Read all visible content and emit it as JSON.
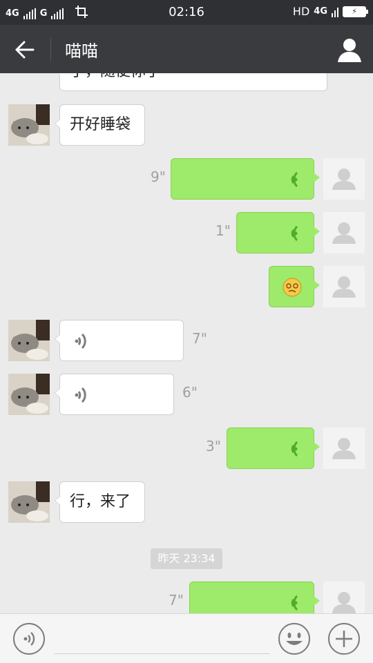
{
  "status_bar": {
    "network_1": "4G",
    "network_2": "G",
    "time": "02:16",
    "hd": "HD",
    "network_3": "4G"
  },
  "header": {
    "title": "喵喵"
  },
  "messages": [
    {
      "id": 1,
      "direction": "incoming",
      "type": "text",
      "text": "了，随便你了"
    },
    {
      "id": 2,
      "direction": "incoming",
      "type": "text",
      "text": "开好睡袋"
    },
    {
      "id": 3,
      "direction": "outgoing",
      "type": "voice",
      "duration": "9\""
    },
    {
      "id": 4,
      "direction": "outgoing",
      "type": "voice",
      "duration": "1\""
    },
    {
      "id": 5,
      "direction": "outgoing",
      "type": "emoji",
      "emoji": "dizzy-face-emoji"
    },
    {
      "id": 6,
      "direction": "incoming",
      "type": "voice",
      "duration": "7\""
    },
    {
      "id": 7,
      "direction": "incoming",
      "type": "voice",
      "duration": "6\""
    },
    {
      "id": 8,
      "direction": "outgoing",
      "type": "voice",
      "duration": "3\""
    },
    {
      "id": 9,
      "direction": "incoming",
      "type": "text",
      "text": "行，来了"
    },
    {
      "id": 10,
      "direction": "outgoing",
      "type": "voice",
      "duration": "7\""
    }
  ],
  "timestamp": "昨天 23:34",
  "input": {
    "value": "",
    "placeholder": ""
  },
  "icons": {
    "back": "back-arrow-icon",
    "profile": "person-icon",
    "voice": "voice-mode-icon",
    "emoji": "smiley-icon",
    "more": "plus-icon"
  },
  "colors": {
    "status_bar": "#2f3034",
    "title_bar": "#3a3b3f",
    "background": "#ebebeb",
    "outgoing_bubble": "#9eea6a",
    "incoming_bubble": "#ffffff",
    "voice_wave_outgoing": "#4fae24",
    "voice_wave_incoming": "#7d7d7d"
  }
}
